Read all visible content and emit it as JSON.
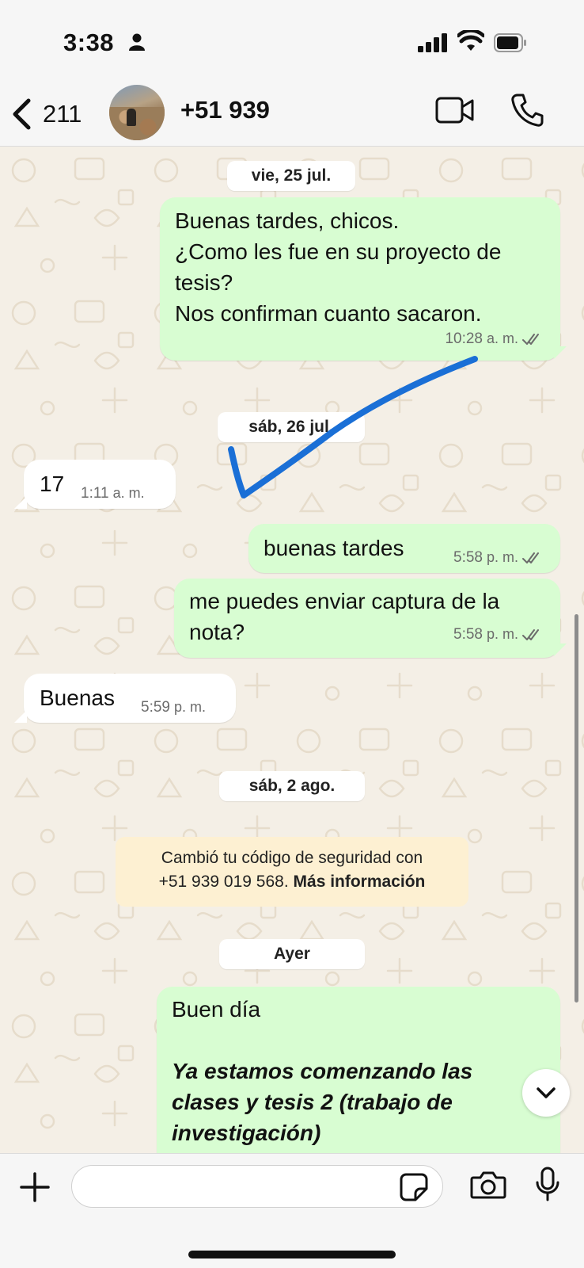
{
  "status_bar": {
    "time": "3:38"
  },
  "header": {
    "back_count": "211",
    "contact_name": "+51 939"
  },
  "dates": {
    "d1": "vie, 25 jul.",
    "d2": "sáb, 26 jul.",
    "d3": "sáb, 2 ago.",
    "d4": "Ayer"
  },
  "messages": [
    {
      "direction": "out",
      "text": "Buenas tardes, chicos.\n¿Como les fue en su proyecto de tesis?\nNos confirman cuanto sacaron.",
      "time": "10:28",
      "ampm": "a. m.",
      "read": true
    },
    {
      "direction": "in",
      "text": "17",
      "time": "1:11",
      "ampm": "a. m."
    },
    {
      "direction": "out",
      "text": "buenas tardes",
      "time": "5:58",
      "ampm": "p. m.",
      "read": true
    },
    {
      "direction": "out",
      "text": "me puedes enviar captura de la nota?",
      "time": "5:58",
      "ampm": "p. m.",
      "read": true
    },
    {
      "direction": "in",
      "text": "Buenas",
      "time": "5:59",
      "ampm": "p. m."
    },
    {
      "direction": "out",
      "text": "Buen día",
      "text_bold_italic": "Ya estamos comenzando las clases y tesis 2 (trabajo de investigación)"
    }
  ],
  "security_notice": {
    "line1": "Cambió tu código de seguridad con",
    "line2_number": "+51 939 019 568.",
    "line2_link": "Más información"
  },
  "input": {
    "placeholder": ""
  },
  "colors": {
    "outgoing_bubble": "#d8fdd2",
    "incoming_bubble": "#ffffff",
    "wallpaper": "#f4efe6",
    "notice_bg": "#fdf0d2",
    "annotation_stroke": "#1a6fd6"
  },
  "icons": {
    "back": "chevron-left-icon",
    "video": "video-camera-icon",
    "phone": "phone-icon",
    "plus": "plus-icon",
    "sticker": "sticker-icon",
    "camera": "camera-icon",
    "mic": "microphone-icon",
    "scroll_down": "chevron-down-icon",
    "read_receipt": "double-check-icon"
  }
}
